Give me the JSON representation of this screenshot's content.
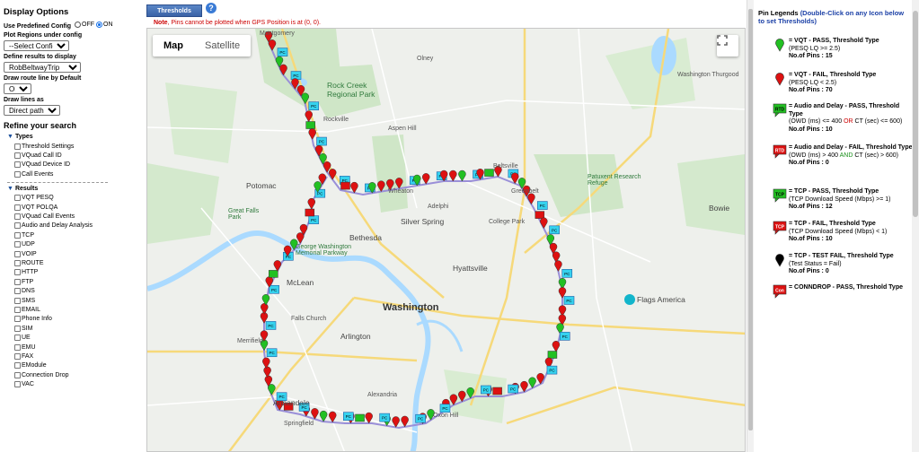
{
  "left": {
    "display_options": "Display Options",
    "predef_label": "Use Predefined Config",
    "off_label": "OFF",
    "on_label": "ON",
    "plot_regions_label": "Plot Regions under config",
    "config_select": "--Select Config--",
    "define_results_label": "Define results to display",
    "results_select": "RobBeltwayTrip",
    "route_line_label": "Draw route line by Default",
    "route_line_select": "ON",
    "draw_lines_label": "Draw lines as",
    "draw_lines_select": "Direct path",
    "refine": "Refine your search",
    "types_label": "Types",
    "types": [
      "Threshold Settings",
      "VQuad Call ID",
      "VQuad Device ID",
      "Call Events"
    ],
    "results_label": "Results",
    "results": [
      "VQT PESQ",
      "VQT POLQA",
      "VQuad Call Events",
      "Audio and Delay Analysis",
      "TCP",
      "UDP",
      "VOIP",
      "ROUTE",
      "HTTP",
      "FTP",
      "DNS",
      "SMS",
      "EMAIL",
      "Phone Info",
      "SIM",
      "UE",
      "EMU",
      "FAX",
      "EModule",
      "Connection Drop",
      "VAC"
    ]
  },
  "top": {
    "thresholds_button": "Thresholds",
    "help_icon": "?",
    "note_prefix": "Note",
    "note_text": ", Pins cannot be plotted when GPS Position is at (0, 0)."
  },
  "map": {
    "map_tab": "Map",
    "satellite_tab": "Satellite",
    "labels": [
      "Montgomery",
      "Washington Thurgood",
      "Rock Creek Regional Park",
      "Aspen Hill",
      "Olney",
      "Silver Spring",
      "Bethesda",
      "Potomac",
      "Great Falls Park",
      "McLean",
      "Washington",
      "Arlington",
      "Annandale",
      "Springfield",
      "Hyattsville",
      "Beltsville",
      "Patuxent Research Refuge",
      "College Park",
      "Greenbelt",
      "Bowie",
      "Flags America",
      "George Washington Memorial Parkway",
      "Falls Church",
      "Merrifield",
      "Wheaton",
      "Adelphi",
      "Oxon Hill",
      "Alexandria",
      "Rockville"
    ],
    "pin_pc_label": "PC"
  },
  "legend": {
    "header_a": "Pin Legends",
    "header_b": "(Double-Click on any Icon below to set Thresholds)",
    "items": [
      {
        "icon": "green-pin-icon",
        "title": "= VQT - PASS, Threshold Type",
        "lines": [
          "(PESQ LQ >= 2.5)"
        ],
        "count": "No.of Pins : 15"
      },
      {
        "icon": "red-pin-icon",
        "title": "= VQT - FAIL, Threshold Type",
        "lines": [
          "(PESQ LQ < 2.5)"
        ],
        "count": "No.of Pins : 70"
      },
      {
        "icon": "rtd-green-icon",
        "title": "= Audio and Delay - PASS, Threshold Type",
        "lines": [
          "(OWD (ms) <= 400 ",
          "OR",
          " CT (sec) <= 600)"
        ],
        "count": "No.of Pins : 10"
      },
      {
        "icon": "rtd-red-icon",
        "title": "= Audio and Delay - FAIL, Threshold Type",
        "lines": [
          "(OWD (ms) > 400 ",
          "AND",
          " CT (sec) > 600)"
        ],
        "count": "No.of Pins : 0"
      },
      {
        "icon": "tcp-green-icon",
        "title": "= TCP - PASS, Threshold Type",
        "lines": [
          "(TCP Download Speed (Mbps) >= 1)"
        ],
        "count": "No.of Pins : 12"
      },
      {
        "icon": "tcp-red-icon",
        "title": "= TCP - FAIL, Threshold Type",
        "lines": [
          "(TCP Download Speed (Mbps) < 1)"
        ],
        "count": "No.of Pins : 10"
      },
      {
        "icon": "black-pin-icon",
        "title": "= TCP - TEST FAIL, Threshold Type",
        "lines": [
          "(Test Status = Fail)"
        ],
        "count": "No.of Pins : 0"
      },
      {
        "icon": "con-red-icon",
        "title": "= CONNDROP - PASS, Threshold Type",
        "lines": [],
        "count": ""
      }
    ],
    "rtd_label": "RTD",
    "tcp_label": "TCP",
    "con_label": "Con"
  },
  "colors": {
    "pass_green": "#22c022",
    "fail_red": "#dd1111",
    "pc_cyan": "#36d2ee",
    "route": "#9a8fd8"
  }
}
